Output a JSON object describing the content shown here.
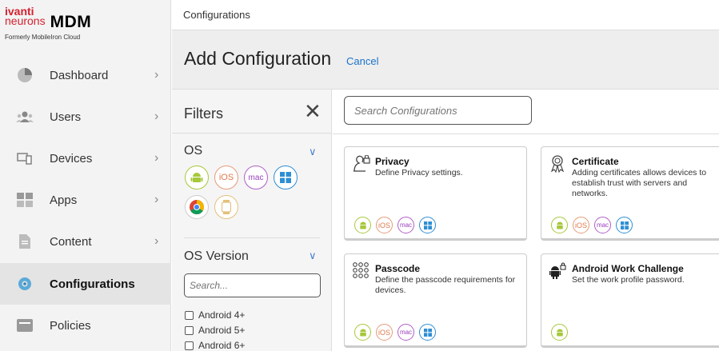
{
  "logo": {
    "line1": "ivanti",
    "line2": "neurons",
    "product": "MDM",
    "formerly": "Formerly MobileIron Cloud"
  },
  "sidebar": {
    "items": [
      {
        "label": "Dashboard",
        "icon": "pie-chart-icon"
      },
      {
        "label": "Users",
        "icon": "users-icon"
      },
      {
        "label": "Devices",
        "icon": "devices-icon"
      },
      {
        "label": "Apps",
        "icon": "apps-grid-icon"
      },
      {
        "label": "Content",
        "icon": "document-icon"
      },
      {
        "label": "Configurations",
        "icon": "gear-icon",
        "active": true
      },
      {
        "label": "Policies",
        "icon": "policy-icon"
      }
    ]
  },
  "topbar": {
    "breadcrumb": "Configurations"
  },
  "header": {
    "title": "Add Configuration",
    "cancel": "Cancel"
  },
  "filters": {
    "title": "Filters",
    "os_label": "OS",
    "os_icons": [
      "android",
      "iOS",
      "mac",
      "windows",
      "chrome",
      "watch"
    ],
    "os_version_label": "OS Version",
    "search_placeholder": "Search...",
    "versions": [
      "Android 4+",
      "Android 5+",
      "Android 6+"
    ]
  },
  "search": {
    "placeholder": "Search Configurations"
  },
  "platform_text": {
    "ios": "iOS",
    "mac": "mac"
  },
  "cards": [
    {
      "title": "Privacy",
      "desc": "Define Privacy settings.",
      "icon": "privacy-icon",
      "platforms": [
        "android",
        "ios",
        "mac",
        "windows"
      ]
    },
    {
      "title": "Certificate",
      "desc": "Adding certificates allows devices to establish trust with servers and networks.",
      "icon": "certificate-icon",
      "platforms": [
        "android",
        "ios",
        "mac",
        "windows"
      ]
    },
    {
      "title": "Passcode",
      "desc": "Define the passcode requirements for devices.",
      "icon": "passcode-icon",
      "platforms": [
        "android",
        "ios",
        "mac",
        "windows"
      ]
    },
    {
      "title": "Android Work Challenge",
      "desc": "Set the work profile password.",
      "icon": "android-lock-icon",
      "platforms": [
        "android"
      ]
    }
  ],
  "colors": {
    "android": "#a6c83a",
    "ios": "#e07a4c",
    "mac": "#9a3fbe",
    "windows": "#2e8ed4",
    "link": "#1a73c9",
    "brand": "#d4212e"
  }
}
